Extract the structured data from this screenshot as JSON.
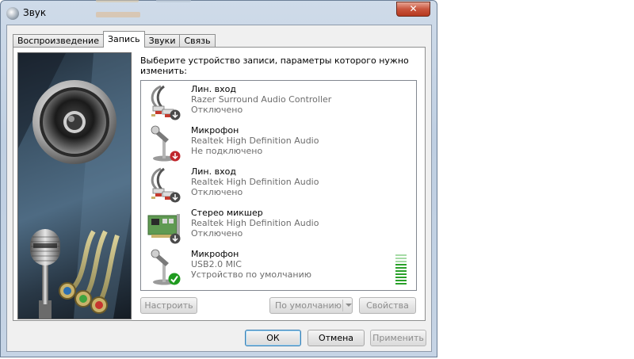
{
  "window": {
    "title": "Звук",
    "close_glyph": "✕"
  },
  "tabs": [
    {
      "label": "Воспроизведение",
      "active": false
    },
    {
      "label": "Запись",
      "active": true
    },
    {
      "label": "Звуки",
      "active": false
    },
    {
      "label": "Связь",
      "active": false
    }
  ],
  "instruction": "Выберите устройство записи, параметры которого нужно изменить:",
  "devices": [
    {
      "name": "Лин. вход",
      "driver": "Razer Surround Audio Controller",
      "status": "Отключено",
      "icon": "line-in-icon",
      "badge": "disabled-arrow"
    },
    {
      "name": "Микрофон",
      "driver": "Realtek High Definition Audio",
      "status": "Не подключено",
      "icon": "microphone-icon",
      "badge": "unplugged-arrow"
    },
    {
      "name": "Лин. вход",
      "driver": "Realtek High Definition Audio",
      "status": "Отключено",
      "icon": "line-in-icon",
      "badge": "disabled-arrow"
    },
    {
      "name": "Стерео микшер",
      "driver": "Realtek High Definition Audio",
      "status": "Отключено",
      "icon": "sound-card-icon",
      "badge": "disabled-arrow"
    },
    {
      "name": "Микрофон",
      "driver": "USB2.0 MIC",
      "status": "Устройство по умолчанию",
      "icon": "microphone-icon",
      "badge": "default-check",
      "level": 0.7
    }
  ],
  "buttons": {
    "configure": "Настроить",
    "set_default": "По умолчанию",
    "properties": "Свойства",
    "ok": "ОК",
    "cancel": "Отмена",
    "apply": "Применить"
  },
  "colors": {
    "accent_default": "#1f9b1f",
    "disabled_arrow": "#4a4a4a",
    "unplugged_arrow": "#c0272d",
    "vu_on": "#2aa12a",
    "vu_off": "#a6dba6"
  }
}
